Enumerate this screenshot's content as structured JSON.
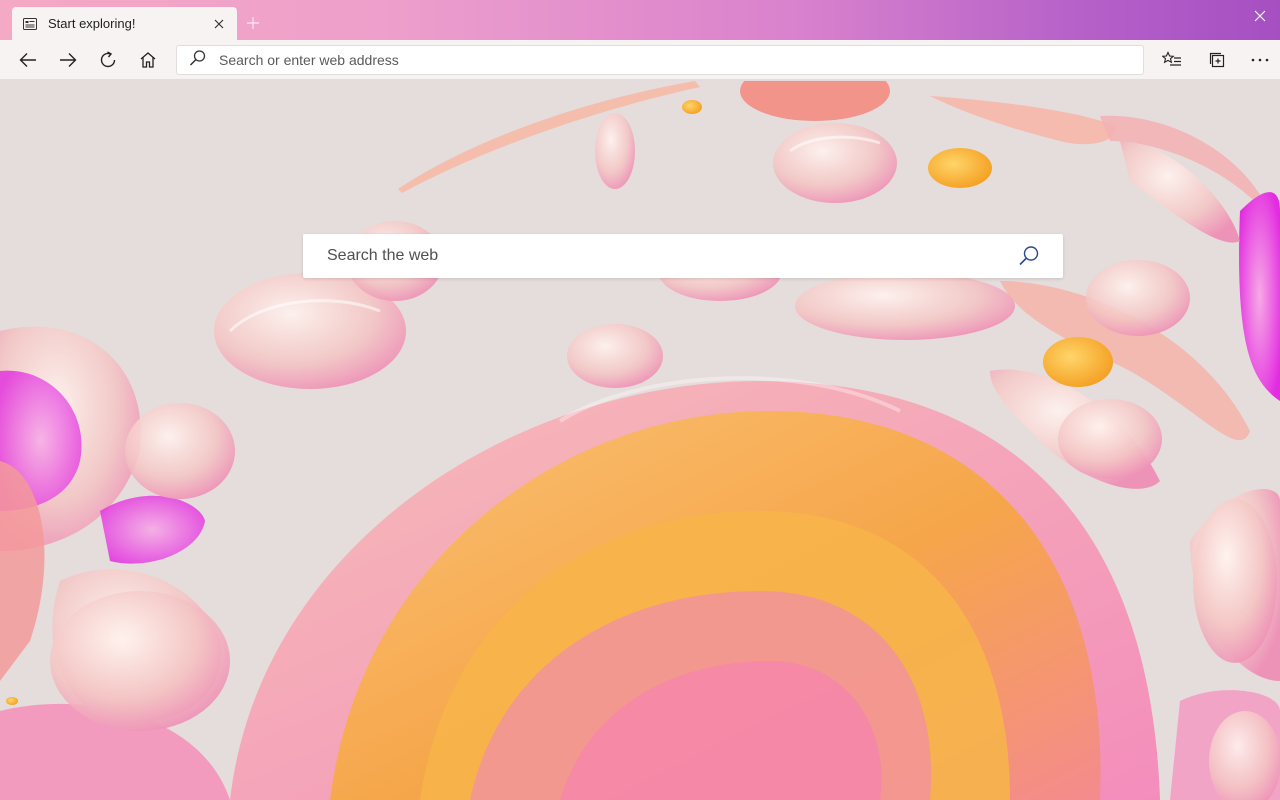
{
  "window": {
    "accent_gradient": [
      "#f4a9c4",
      "#a54fc2"
    ],
    "close_icon": "close-icon"
  },
  "tab": {
    "title": "Start exploring!",
    "favicon": "new-tab-page-icon",
    "close_icon": "close-icon"
  },
  "new_tab_icon": "plus-icon",
  "toolbar": {
    "back_icon": "arrow-left-icon",
    "forward_icon": "arrow-right-icon",
    "refresh_icon": "refresh-icon",
    "home_icon": "home-icon",
    "favorites_icon": "favorites-list-icon",
    "collections_icon": "collections-icon",
    "more_icon": "more-icon"
  },
  "address_bar": {
    "placeholder": "Search or enter web address",
    "value": ""
  },
  "web_search": {
    "placeholder": "Search the web",
    "value": "",
    "icon": "search-icon"
  }
}
